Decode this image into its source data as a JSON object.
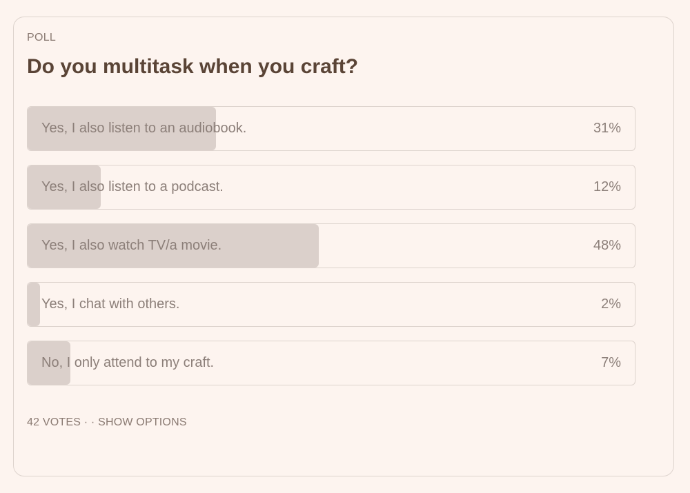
{
  "poll": {
    "kicker": "POLL",
    "question": "Do you multitask when you craft?",
    "options": [
      {
        "label": "Yes, I also listen to an audiobook.",
        "percent_text": "31%",
        "fill_fraction": 0.31
      },
      {
        "label": "Yes, I also listen to a podcast.",
        "percent_text": "12%",
        "fill_fraction": 0.12
      },
      {
        "label": "Yes, I also watch TV/a movie.",
        "percent_text": "48%",
        "fill_fraction": 0.48
      },
      {
        "label": "Yes, I chat with others.",
        "percent_text": "2%",
        "fill_fraction": 0.02
      },
      {
        "label": "No, I only attend to my craft.",
        "percent_text": "7%",
        "fill_fraction": 0.07
      }
    ],
    "footer": {
      "votes": "42 VOTES",
      "separator": " · · ",
      "show_options": "SHOW OPTIONS"
    }
  },
  "colors": {
    "background": "#fdf4ef",
    "fill": "#dbd0cb",
    "title": "#5a4436",
    "muted_text": "#8c7f79",
    "border": "#ddd3cd"
  }
}
